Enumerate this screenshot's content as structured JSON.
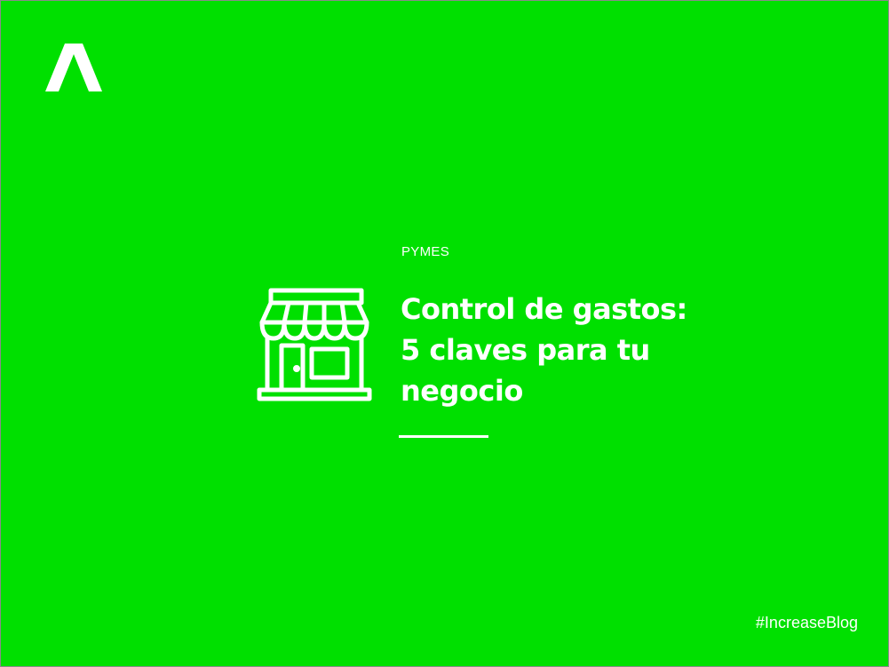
{
  "brand": {
    "logo_icon": "increase-logo-icon",
    "background_color": "#00e000",
    "foreground_color": "#ffffff"
  },
  "article": {
    "category": "PYMES",
    "title_lines": [
      "Control de gastos:",
      "5 claves para tu",
      "negocio"
    ],
    "icon": "storefront-icon"
  },
  "footer": {
    "hashtag": "#IncreaseBlog"
  }
}
